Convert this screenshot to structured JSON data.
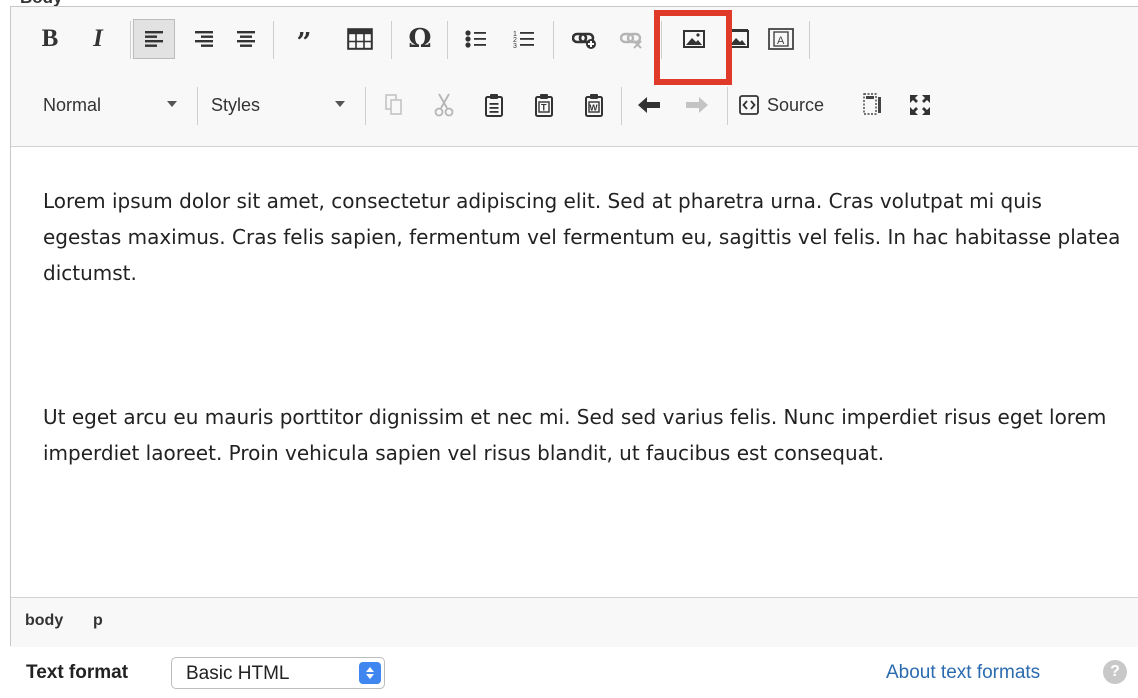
{
  "field": {
    "label": "Body"
  },
  "toolbar": {
    "row1": {
      "bold_glyph": "B",
      "italic_glyph": "I",
      "blockquote_glyph": "”",
      "special_char_glyph": "Ω"
    },
    "row2": {
      "format_combo_value": "Normal",
      "styles_combo_value": "Styles",
      "source_label": "Source"
    },
    "highlight_color": "#e03a2a"
  },
  "content": {
    "paragraphs": [
      "Lorem ipsum dolor sit amet, consectetur adipiscing elit. Sed at pharetra urna. Cras volutpat mi quis egestas maximus. Cras felis sapien, fermentum vel fermentum eu, sagittis vel felis. In hac habitasse platea dictumst.",
      "Ut eget arcu eu mauris porttitor dignissim et nec mi. Sed sed varius felis. Nunc imperdiet risus eget lorem imperdiet laoreet. Proin vehicula sapien vel risus blandit, ut faucibus est consequat."
    ]
  },
  "pathbar": {
    "items": [
      "body",
      "p"
    ]
  },
  "text_format": {
    "label": "Text format",
    "selected": "Basic HTML",
    "about_link": "About text formats",
    "help_glyph": "?",
    "link_color": "#2a6bb0"
  }
}
